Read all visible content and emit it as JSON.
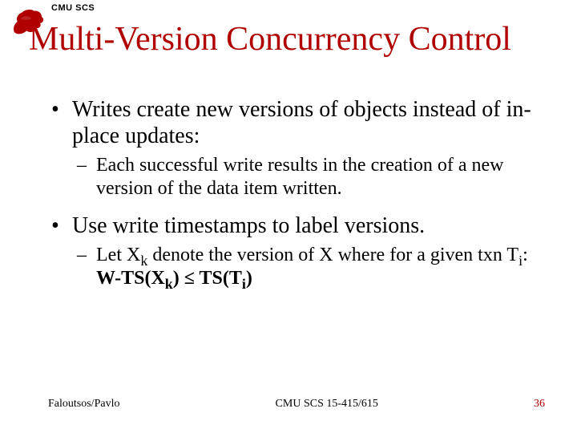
{
  "header": {
    "dept": "CMU SCS"
  },
  "title": "Multi-Version Concurrency Control",
  "bullets": [
    {
      "text": "Writes create new versions of objects instead of in-place updates:",
      "subs": [
        {
          "text": "Each successful write results in the creation of a new version of the data item written."
        }
      ]
    },
    {
      "text": "Use write timestamps to label versions.",
      "subs": [
        {
          "prefix": "Let X",
          "k1": "k",
          "mid1": " denote the version of X where for a given txn T",
          "i1": "i",
          "mid2": ": ",
          "b1a": "W-TS(X",
          "bk": "k",
          "b1b": ") ≤ TS(T",
          "bi": "i",
          "b1c": ")"
        }
      ]
    }
  ],
  "footer": {
    "left": "Faloutsos/Pavlo",
    "center": "CMU SCS 15-415/615",
    "right": "36"
  }
}
